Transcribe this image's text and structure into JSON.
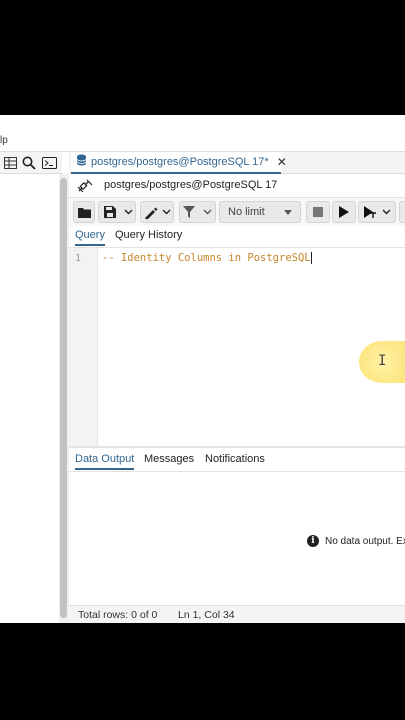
{
  "menu": {
    "fragment": "lp"
  },
  "left_toolbar": {
    "icons": [
      "table-grid-icon",
      "search-icon",
      "terminal-icon"
    ]
  },
  "tab": {
    "label": "postgres/postgres@PostgreSQL 17*",
    "close": "✕",
    "icon": "database-icon"
  },
  "connection": {
    "label": "postgres/postgres@PostgreSQL 17",
    "icon": "plug-disconnected-icon"
  },
  "query_toolbar": {
    "limit": "No limit",
    "buttons": [
      "open-file",
      "save-file",
      "save-dropdown",
      "edit",
      "edit-dropdown",
      "filter",
      "filter-dropdown",
      "limit-select",
      "stop",
      "execute",
      "explain",
      "execute-dropdown"
    ]
  },
  "query_tabs": {
    "query": "Query",
    "history": "Query History"
  },
  "editor": {
    "line_number": "1",
    "code": "-- Identity Columns in PostgreSQL"
  },
  "output_tabs": {
    "data_output": "Data Output",
    "messages": "Messages",
    "notifications": "Notifications"
  },
  "output": {
    "message": "No data output. Ex"
  },
  "status": {
    "rows": "Total rows: 0 of 0",
    "position": "Ln 1, Col 34"
  },
  "colors": {
    "accent": "#326690",
    "comment": "#c4862a",
    "highlight": "#fde889"
  }
}
